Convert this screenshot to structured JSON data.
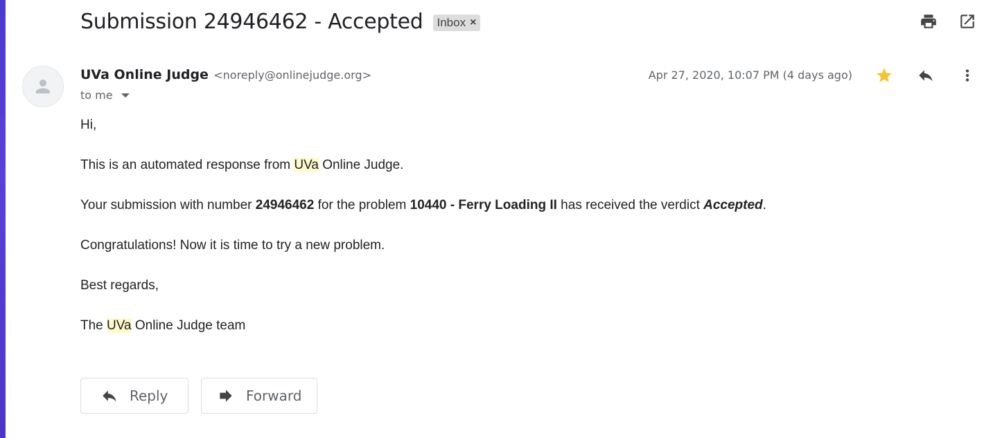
{
  "email": {
    "subject": "Submission 24946462 - Accepted",
    "label": "Inbox",
    "label_remove": "×",
    "sender_name": "UVa Online Judge",
    "sender_email": "<noreply@onlinejudge.org>",
    "to": "to me",
    "date": "Apr 27, 2020, 10:07 PM (4 days ago)",
    "starred": true,
    "star_color": "#f4c430",
    "body": {
      "greeting": "Hi,",
      "line1_before": "This is an automated response from ",
      "line1_highlight": "UVa",
      "line1_after": " Online Judge.",
      "line2_a": "Your submission with number ",
      "line2_number": "24946462",
      "line2_b": " for the problem ",
      "line2_problem": "10440 - Ferry Loading II",
      "line2_c": " has received the verdict ",
      "line2_verdict": "Accepted",
      "line2_d": ".",
      "line3": "Congratulations! Now it is time to try a new problem.",
      "line4": "Best regards,",
      "line5_before": "The ",
      "line5_highlight": "UVa",
      "line5_after": " Online Judge team"
    }
  },
  "actions": {
    "reply_label": "Reply",
    "forward_label": "Forward"
  },
  "icons": {
    "print": "print-icon",
    "open_new_window": "open-in-new-icon",
    "star": "star-icon",
    "reply": "reply-icon",
    "more": "more-vert-icon",
    "forward": "forward-icon",
    "avatar": "person-icon"
  }
}
